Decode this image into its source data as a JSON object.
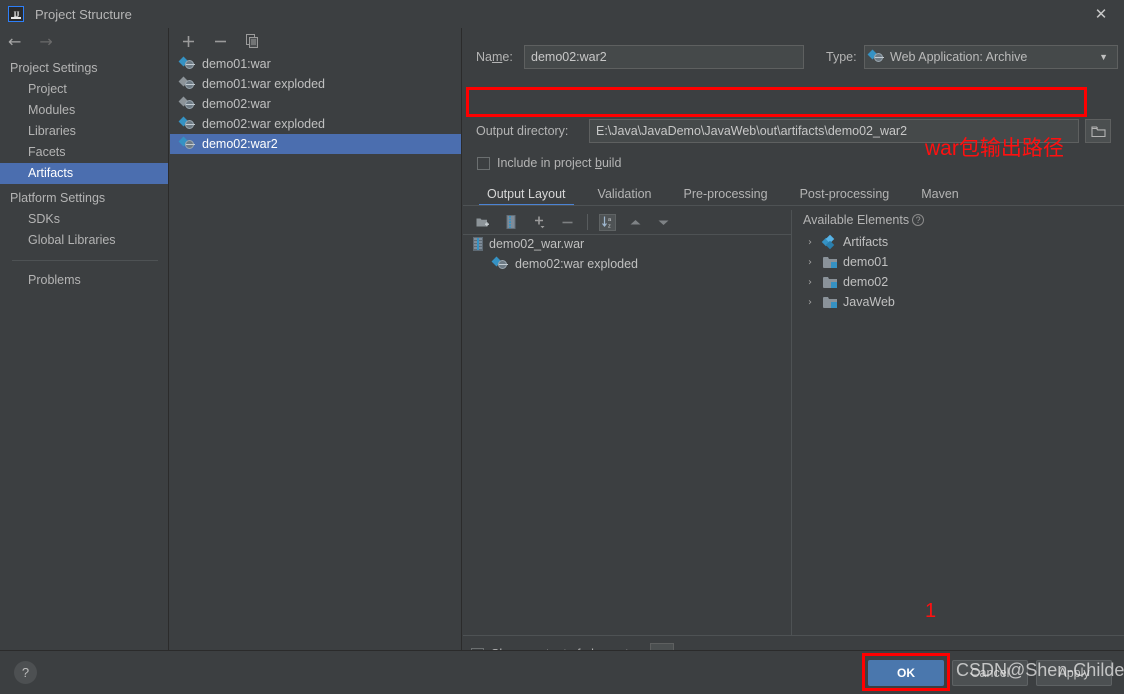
{
  "window": {
    "title": "Project Structure",
    "app_icon": "intellij-idea-icon",
    "close_label": "✕"
  },
  "colors": {
    "background": "#3c3f41",
    "selection": "#4b6eaf",
    "accent_blue": "#3592c4",
    "annotation_red": "#ff0000",
    "ok_button": "#4a77ad"
  },
  "nav": {
    "back": "←",
    "forward": "→"
  },
  "sidebar": {
    "groups": [
      {
        "label": "Project Settings",
        "items": [
          {
            "label": "Project",
            "selected": false
          },
          {
            "label": "Modules",
            "selected": false
          },
          {
            "label": "Libraries",
            "selected": false
          },
          {
            "label": "Facets",
            "selected": false
          },
          {
            "label": "Artifacts",
            "selected": true
          }
        ]
      },
      {
        "label": "Platform Settings",
        "items": [
          {
            "label": "SDKs",
            "selected": false
          },
          {
            "label": "Global Libraries",
            "selected": false
          }
        ]
      }
    ],
    "problems": "Problems"
  },
  "artifacts_panel": {
    "toolbar": [
      {
        "name": "add-artifact-button",
        "glyph": "+"
      },
      {
        "name": "remove-artifact-button",
        "glyph": "−"
      },
      {
        "name": "copy-artifact-button",
        "glyph": "copy-icon"
      }
    ],
    "items": [
      {
        "label": "demo01:war",
        "selected": false
      },
      {
        "label": "demo01:war exploded",
        "selected": false
      },
      {
        "label": "demo02:war",
        "selected": false
      },
      {
        "label": "demo02:war exploded",
        "selected": false
      },
      {
        "label": "demo02:war2",
        "selected": true
      }
    ]
  },
  "detail": {
    "name_label": "Na",
    "name_label_mnemonic": "m",
    "name_label_rest": "e:",
    "name_value": "demo02:war2",
    "type_label": "Type:",
    "type_value": "Web Application: Archive",
    "output_directory_label": "Output directory:",
    "output_directory_value": "E:\\Java\\JavaDemo\\JavaWeb\\out\\artifacts\\demo02_war2",
    "browse_icon": "folder-icon",
    "include_in_build_label_pre": "Include in project ",
    "include_in_build_mnemonic": "b",
    "include_in_build_label_post": "uild",
    "include_in_build_checked": false,
    "tabs": [
      {
        "label": "Output Layout",
        "active": true
      },
      {
        "label": "Validation",
        "active": false
      },
      {
        "label": "Pre-processing",
        "active": false
      },
      {
        "label": "Post-processing",
        "active": false
      },
      {
        "label": "Maven",
        "active": false
      }
    ],
    "layout_toolbar": [
      {
        "name": "create-directory-button",
        "glyph": "new-folder-icon"
      },
      {
        "name": "create-archive-button",
        "glyph": "archive-icon"
      },
      {
        "name": "add-copy-button",
        "glyph": "plus-dropdown-icon"
      },
      {
        "name": "remove-element-button",
        "glyph": "minus-icon"
      },
      {
        "name": "sort-alphabetically-button",
        "glyph": "sort-az-icon"
      },
      {
        "name": "move-up-button",
        "glyph": "arrow-up-icon"
      },
      {
        "name": "move-down-button",
        "glyph": "arrow-down-icon"
      }
    ],
    "output_tree": [
      {
        "label": "demo02_war.war",
        "icon": "jar-icon",
        "indent": 0
      },
      {
        "label": "demo02:war exploded",
        "icon": "artifact-icon",
        "indent": 1
      }
    ],
    "available_elements_label": "Available Elements",
    "available_elements_help": "?",
    "available_tree": [
      {
        "label": "Artifacts",
        "icon": "artifacts-group-icon",
        "arrow": "›"
      },
      {
        "label": "demo01",
        "icon": "module-icon",
        "arrow": "›"
      },
      {
        "label": "demo02",
        "icon": "module-icon",
        "arrow": "›"
      },
      {
        "label": "JavaWeb",
        "icon": "module-icon",
        "arrow": "›"
      }
    ],
    "show_content_label": "Show content of elements",
    "show_content_checked": false,
    "ellipsis_label": "..."
  },
  "bottom": {
    "help_label": "?",
    "ok_label": "OK",
    "cancel_label": "Cancel",
    "apply_label": "Apply"
  },
  "annotations": {
    "output_path_note": "war包输出路径",
    "step_one": "1",
    "watermark": "CSDN@Shen-Childe"
  }
}
